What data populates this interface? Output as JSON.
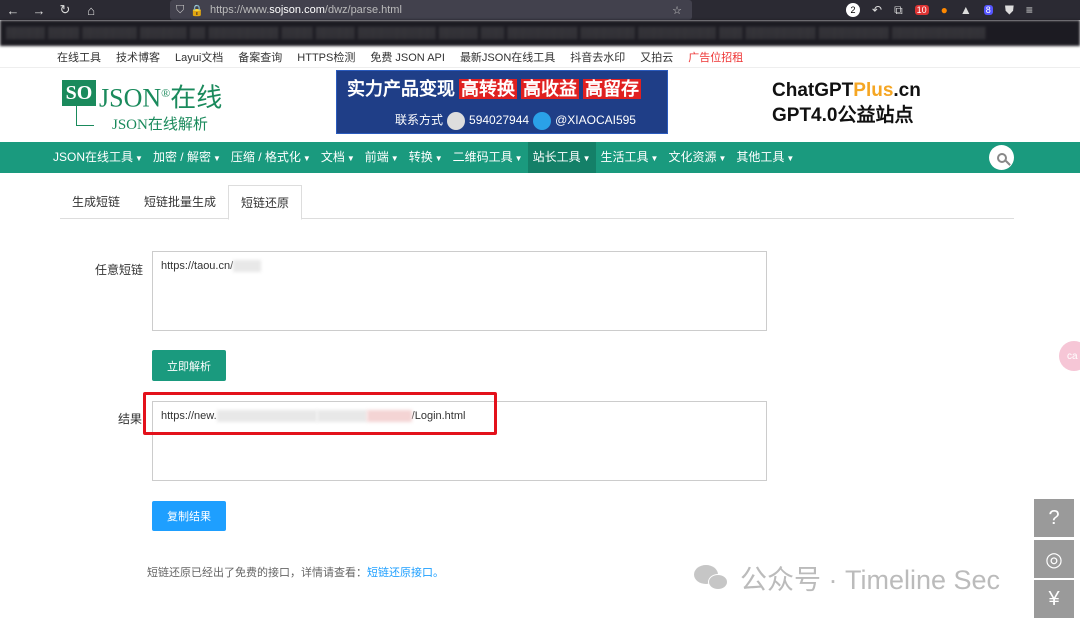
{
  "browser": {
    "back_icon": "←",
    "forward_icon": "→",
    "reload_icon": "↻",
    "home_icon": "⌂",
    "url_prefix": "https://www.",
    "url_host": "sojson.com",
    "url_path": "/dwz/parse.html",
    "badge_count_1": "2",
    "badge_count_2": "10",
    "badge_count_3": "8"
  },
  "top_links": [
    "在线工具",
    "技术博客",
    "Layui文档",
    "备案查询",
    "HTTPS检测",
    "免费 JSON API",
    "最新JSON在线工具",
    "抖音去水印",
    "又拍云",
    "广告位招租"
  ],
  "logo": {
    "so": "SO",
    "json": "JSON",
    "reg": "®",
    "online": "在线",
    "sub": "JSON在线解析"
  },
  "banner": {
    "headline": "实力产品变现",
    "tag1": "高转换",
    "tag2": "高收益",
    "tag3": "高留存",
    "contact_label": "联系方式",
    "qq": "594027944",
    "telegram": "@XIAOCAI595"
  },
  "promo": {
    "line1_a": "ChatGPT",
    "line1_b": "Plus",
    "line1_c": ".cn",
    "line2": "GPT4.0公益站点"
  },
  "main_nav": [
    "JSON在线工具",
    "加密 / 解密",
    "压缩 / 格式化",
    "文档",
    "前端",
    "转换",
    "二维码工具",
    "站长工具",
    "生活工具",
    "文化资源",
    "其他工具"
  ],
  "main_nav_active": "站长工具",
  "tabs": [
    "生成短链",
    "短链批量生成",
    "短链还原"
  ],
  "active_tab": "短链还原",
  "form": {
    "short_label": "任意短链",
    "short_value": "https://taou.cn/",
    "parse_button": "立即解析",
    "result_label": "结果",
    "result_prefix": "https://new.",
    "result_suffix": "/Login.html",
    "copy_button": "复制结果"
  },
  "note": {
    "text": "短链还原已经出了免费的接口，详情请查看：",
    "link": "短链还原接口。"
  },
  "watermark": {
    "text": "公众号 · Timeline Sec"
  },
  "side_buttons": {
    "feedback": "?",
    "qq": "◎",
    "donate": "¥"
  },
  "colors": {
    "nav_green": "#1a9a7e",
    "brand_green": "#1a8a5c",
    "button_blue": "#1e9fff",
    "highlight_red": "#e3111b"
  }
}
